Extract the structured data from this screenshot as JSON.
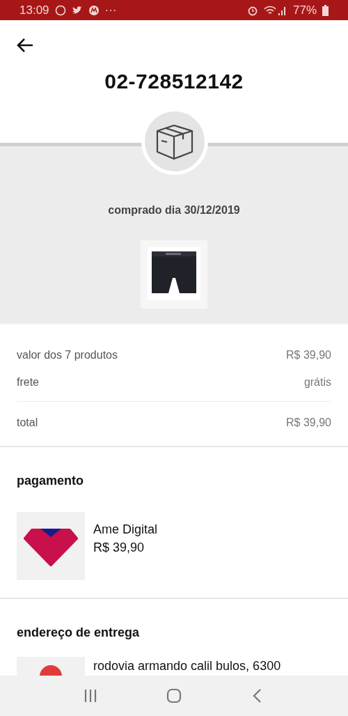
{
  "status_bar": {
    "time": "13:09",
    "more": "···",
    "battery_text": "77%"
  },
  "header": {
    "title": "02-728512142"
  },
  "order": {
    "purchase_date": "comprado dia 30/12/2019"
  },
  "summary": {
    "rows": [
      {
        "label": "valor dos 7 produtos",
        "value": "R$ 39,90"
      },
      {
        "label": "frete",
        "value": "grátis"
      }
    ],
    "total": {
      "label": "total",
      "value": "R$ 39,90"
    }
  },
  "payment": {
    "title": "pagamento",
    "method": "Ame Digital",
    "amount": "R$ 39,90"
  },
  "delivery": {
    "title": "endereço de entrega",
    "address": "rodovia armando calil bulos, 6300"
  }
}
